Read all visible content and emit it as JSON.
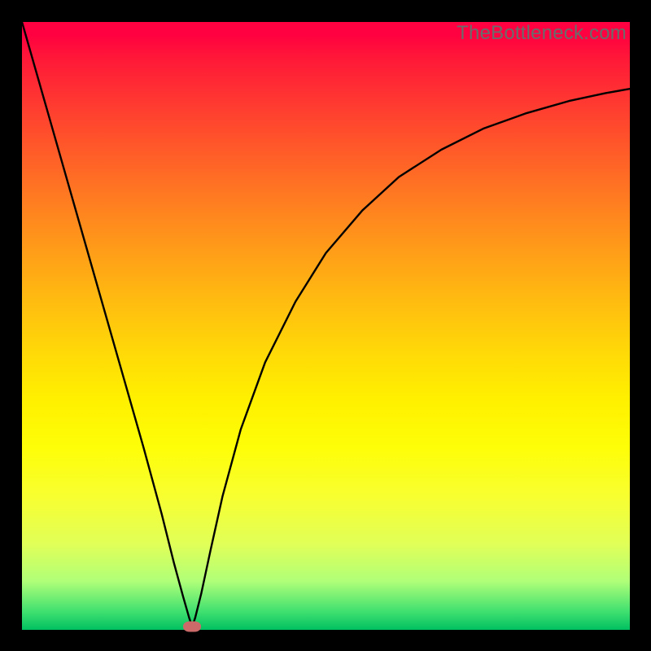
{
  "watermark": "TheBottleneck.com",
  "colors": {
    "frame": "#000000",
    "curve": "#000000",
    "marker": "#cc6a6a"
  },
  "chart_data": {
    "type": "line",
    "title": "",
    "xlabel": "",
    "ylabel": "",
    "xlim": [
      0,
      100
    ],
    "ylim": [
      0,
      100
    ],
    "background_gradient": {
      "top": "#ff0040",
      "bottom": "#00c060",
      "meaning": "red = high bottleneck, green = low bottleneck"
    },
    "marker": {
      "x": 28,
      "y": 0.5
    },
    "series": [
      {
        "name": "bottleneck-curve",
        "x": [
          0,
          4,
          8,
          12,
          16,
          20,
          23,
          25,
          26.5,
          27.5,
          28,
          28.5,
          29.5,
          31,
          33,
          36,
          40,
          45,
          50,
          56,
          62,
          69,
          76,
          83,
          90,
          96,
          100
        ],
        "y": [
          100,
          86,
          72,
          58,
          44,
          30,
          19,
          11,
          5.5,
          2,
          0.5,
          2,
          6,
          13,
          22,
          33,
          44,
          54,
          62,
          69,
          74.5,
          79,
          82.5,
          85,
          87,
          88.3,
          89
        ]
      }
    ]
  }
}
